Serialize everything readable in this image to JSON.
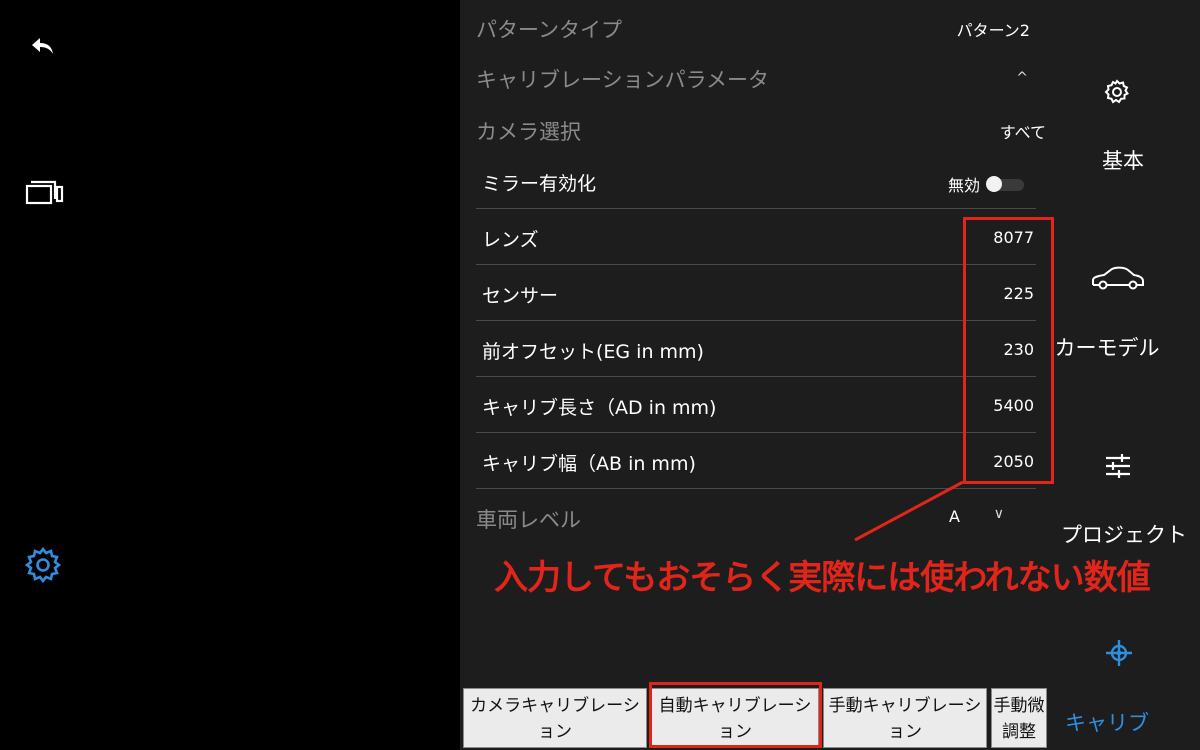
{
  "left_rail": {
    "back_icon": "back-arrow-icon",
    "camera_icon": "dual-camera-icon",
    "settings_icon": "settings-gear-icon",
    "accent_color": "#2e8fe0"
  },
  "settings": {
    "pattern_type": {
      "label": "パターンタイプ",
      "value": "パターン2"
    },
    "calibration_params": {
      "label": "キャリブレーションパラメータ",
      "chevron": "^"
    },
    "camera_select": {
      "label": "カメラ選択",
      "value": "すべて"
    },
    "mirror": {
      "label": "ミラー有効化",
      "value": "無効"
    },
    "items": [
      {
        "label": "レンズ",
        "value": "8077"
      },
      {
        "label": "センサー",
        "value": "225"
      },
      {
        "label": "前オフセット(EG in mm)",
        "value": "230"
      },
      {
        "label": "キャリブ長さ（AD in mm)",
        "value": "5400"
      },
      {
        "label": "キャリブ幅（AB in mm)",
        "value": "2050"
      }
    ],
    "vehicle_level": {
      "label": "車両レベル",
      "value": "A",
      "chevron": "∨"
    }
  },
  "tabs": [
    {
      "label": "カメラキャリブレーション"
    },
    {
      "label": "自動キャリブレーション"
    },
    {
      "label": "手動キャリブレーション"
    },
    {
      "label": "手動微調整"
    }
  ],
  "right_nav": {
    "items": [
      {
        "label": "基本",
        "icon": "gear-icon"
      },
      {
        "label": "カーモデル",
        "icon": "car-icon"
      },
      {
        "label": "プロジェクト",
        "icon": "sliders-icon"
      },
      {
        "label": "キャリブ",
        "icon": "crosshair-icon",
        "active": true
      }
    ]
  },
  "annotation": {
    "text": "入力してもおそらく実際には使われない数値",
    "color": "#e1251b"
  }
}
